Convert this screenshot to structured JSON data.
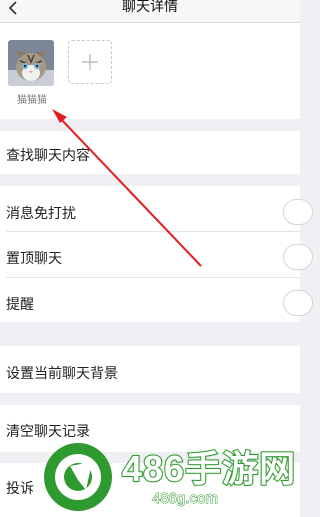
{
  "header": {
    "title": "聊天详情",
    "back_icon": "chevron-left-icon"
  },
  "members": {
    "list": [
      {
        "name": "猫猫猫",
        "avatar": "cat-avatar"
      }
    ],
    "add_icon": "plus-icon"
  },
  "settings": {
    "search_chat": "查找聊天内容",
    "mute": {
      "label": "消息免打扰",
      "on": false
    },
    "pin": {
      "label": "置顶聊天",
      "on": false
    },
    "remind": {
      "label": "提醒",
      "on": false
    },
    "set_background": "设置当前聊天背景",
    "clear_history": "清空聊天记录",
    "report": "投诉"
  },
  "watermark": {
    "text": "486手游网",
    "url": "486g.com"
  },
  "colors": {
    "arrow": "#e02020",
    "page_bg": "#efeff4",
    "watermark_green": "#2f9a2f"
  }
}
